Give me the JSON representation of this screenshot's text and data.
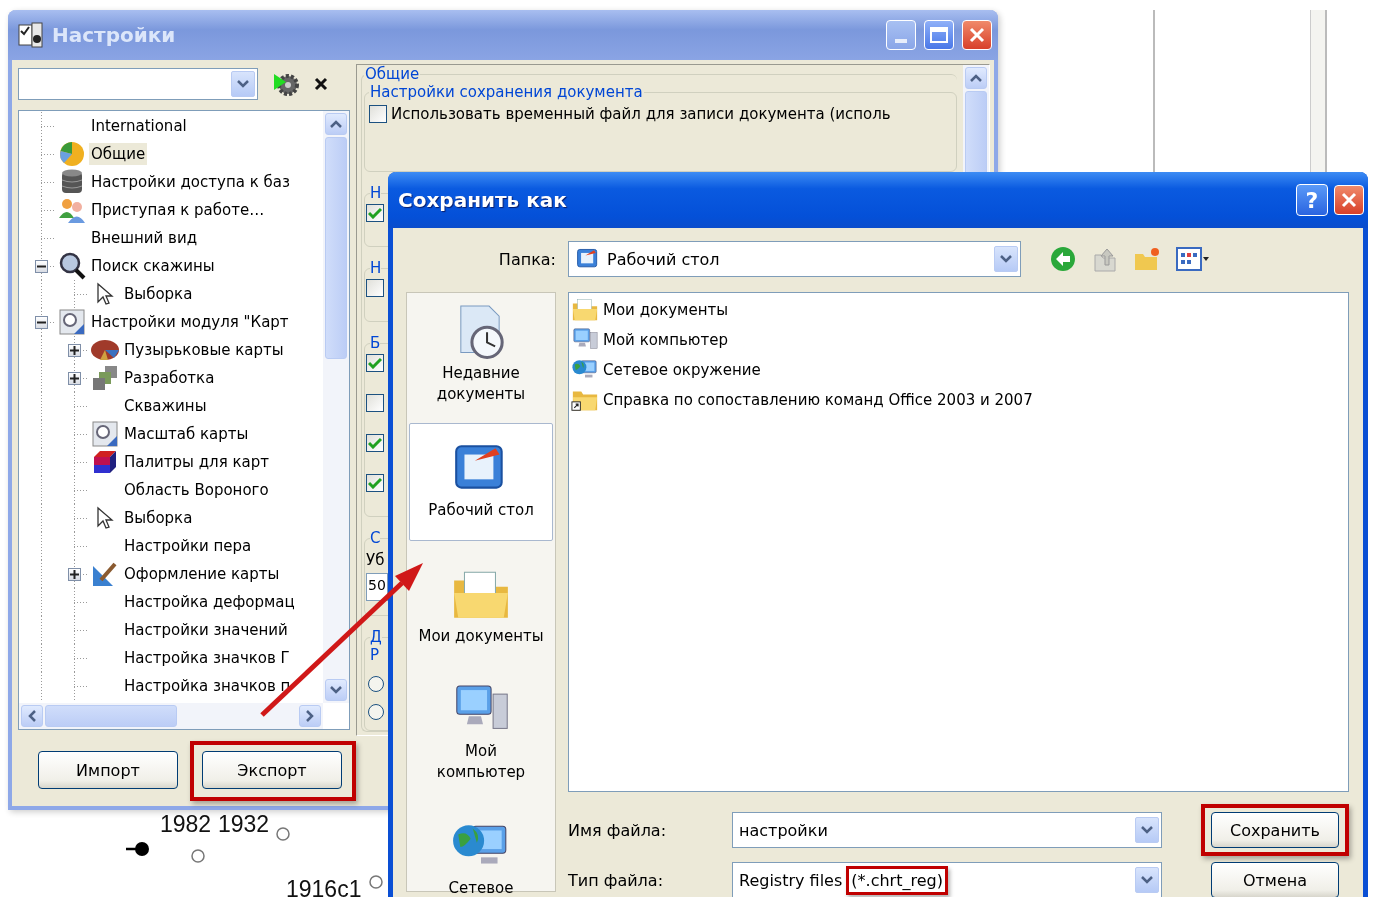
{
  "background": {
    "labels": [
      "1982",
      "1932",
      "1916c1"
    ]
  },
  "settings_window": {
    "title": "Настройки",
    "tree": [
      {
        "label": "International",
        "kind": "none",
        "selected": false
      },
      {
        "label": "Общие",
        "kind": "pie",
        "selected": true
      },
      {
        "label": "Настройки доступа к баз",
        "kind": "database",
        "selected": false
      },
      {
        "label": "Приступая к работе…",
        "kind": "people",
        "selected": false
      },
      {
        "label": "Внешний вид",
        "kind": "none",
        "selected": false
      },
      {
        "label": "Поиск скажины",
        "kind": "magnifier",
        "selected": false,
        "expanded": true,
        "children": [
          {
            "label": "Выборка",
            "kind": "cursor",
            "selected": false
          }
        ]
      },
      {
        "label": "Настройки модуля \"Карт",
        "kind": "map",
        "selected": false,
        "expanded": true,
        "children": [
          {
            "label": "Пузырьковые карты",
            "kind": "bubble",
            "selected": false,
            "expanded": false
          },
          {
            "label": "Разработка",
            "kind": "blocks",
            "selected": false,
            "expanded": false
          },
          {
            "label": "Скважины",
            "kind": "none",
            "selected": false
          },
          {
            "label": "Масштаб карты",
            "kind": "map",
            "selected": false
          },
          {
            "label": "Палитры для карт",
            "kind": "cube",
            "selected": false
          },
          {
            "label": "Область Вороного",
            "kind": "none",
            "selected": false
          },
          {
            "label": "Выборка",
            "kind": "cursor",
            "selected": false
          },
          {
            "label": "Настройки пера",
            "kind": "none",
            "selected": false
          },
          {
            "label": "Оформление карты",
            "kind": "ruler",
            "selected": false,
            "expanded": false
          },
          {
            "label": "Настройка деформац",
            "kind": "none",
            "selected": false
          },
          {
            "label": "Настройки значений",
            "kind": "none",
            "selected": false
          },
          {
            "label": "Настройка значков Г",
            "kind": "none",
            "selected": false
          },
          {
            "label": "Настройка значков п",
            "kind": "none",
            "selected": false
          }
        ]
      }
    ],
    "panel": {
      "group": "Общие",
      "subgroup": "Настройки сохранения документа",
      "option": {
        "label": "Использовать временный файл для записи документа (исполь",
        "checked": false
      },
      "sections": [
        {
          "heading": "Н",
          "rows": [
            {
              "kind": "checkbox",
              "checked": true
            }
          ]
        },
        {
          "heading": "Н",
          "rows": [
            {
              "kind": "checkbox",
              "checked": false
            }
          ]
        },
        {
          "heading": "Б",
          "rows": [
            {
              "kind": "checkbox",
              "checked": true
            },
            {
              "kind": "checkbox",
              "checked": false
            },
            {
              "kind": "checkbox",
              "checked": true
            },
            {
              "kind": "checkbox",
              "checked": true
            }
          ]
        },
        {
          "heading": "С",
          "rows": [
            {
              "kind": "label",
              "text": "Уб"
            },
            {
              "kind": "field",
              "value": "50"
            }
          ]
        },
        {
          "heading": "Д",
          "rows": [
            {
              "kind": "subheading",
              "text": "Р"
            },
            {
              "kind": "radio",
              "selected": false
            },
            {
              "kind": "radio",
              "selected": false
            }
          ]
        }
      ]
    },
    "buttons": [
      {
        "label": "Импорт",
        "highlighted": false
      },
      {
        "label": "Экспорт",
        "highlighted": true
      }
    ]
  },
  "save_dialog": {
    "title": "Сохранить как",
    "help": "?",
    "folder_label": "Папка:",
    "folder": "Рабочий стол",
    "places": [
      {
        "label": "Недавние\nдокументы",
        "kind": "recent",
        "selected": false
      },
      {
        "label": "Рабочий стол",
        "kind": "desktop",
        "selected": true
      },
      {
        "label": "Мои документы",
        "kind": "documents",
        "selected": false
      },
      {
        "label": "Мой\nкомпьютер",
        "kind": "computer",
        "selected": false
      },
      {
        "label": "Сетевое",
        "kind": "network",
        "selected": false
      }
    ],
    "files": [
      {
        "label": "Мои документы",
        "kind": "documents"
      },
      {
        "label": "Мой компьютер",
        "kind": "computer"
      },
      {
        "label": "Сетевое окружение",
        "kind": "network"
      },
      {
        "label": "Справка по сопоставлению команд Office 2003 и 2007",
        "kind": "shortcut"
      }
    ],
    "file_name_label": "Имя файла:",
    "file_name": "настройки",
    "file_type_label": "Тип файла:",
    "file_type": "Registry files",
    "file_type_highlight": "(*.chrt_reg)",
    "buttons": [
      {
        "label": "Сохранить",
        "highlighted": true
      },
      {
        "label": "Отмена",
        "highlighted": false
      }
    ]
  }
}
